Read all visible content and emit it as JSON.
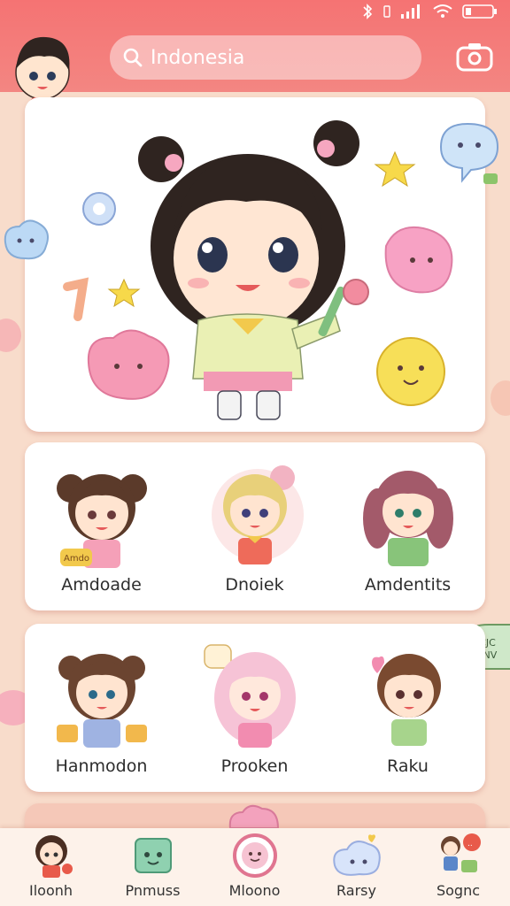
{
  "app": {
    "search_value": "Indonesia",
    "accent_color": "#f57373",
    "background_color": "#f8dccb"
  },
  "status_bar": {
    "icons": [
      "bluetooth-icon",
      "vibrate-icon",
      "signal-icon",
      "wifi-icon",
      "battery-icon"
    ]
  },
  "header": {
    "camera_icon": "camera-icon",
    "search_icon": "search-icon"
  },
  "hero": {
    "character": "featured-character-sticker"
  },
  "grid": {
    "row1": [
      {
        "label": "Amdoade",
        "badge": "Amdoade"
      },
      {
        "label": "Dnoiek"
      },
      {
        "label": "Amdentits"
      }
    ],
    "row2": [
      {
        "label": "Hanmodon"
      },
      {
        "label": "Prooken"
      },
      {
        "label": "Raku"
      }
    ]
  },
  "tabs": [
    {
      "label": "Iloonh"
    },
    {
      "label": "Pnmuss"
    },
    {
      "label": "Mloono"
    },
    {
      "label": "Rarsy"
    },
    {
      "label": "Sognc"
    }
  ]
}
